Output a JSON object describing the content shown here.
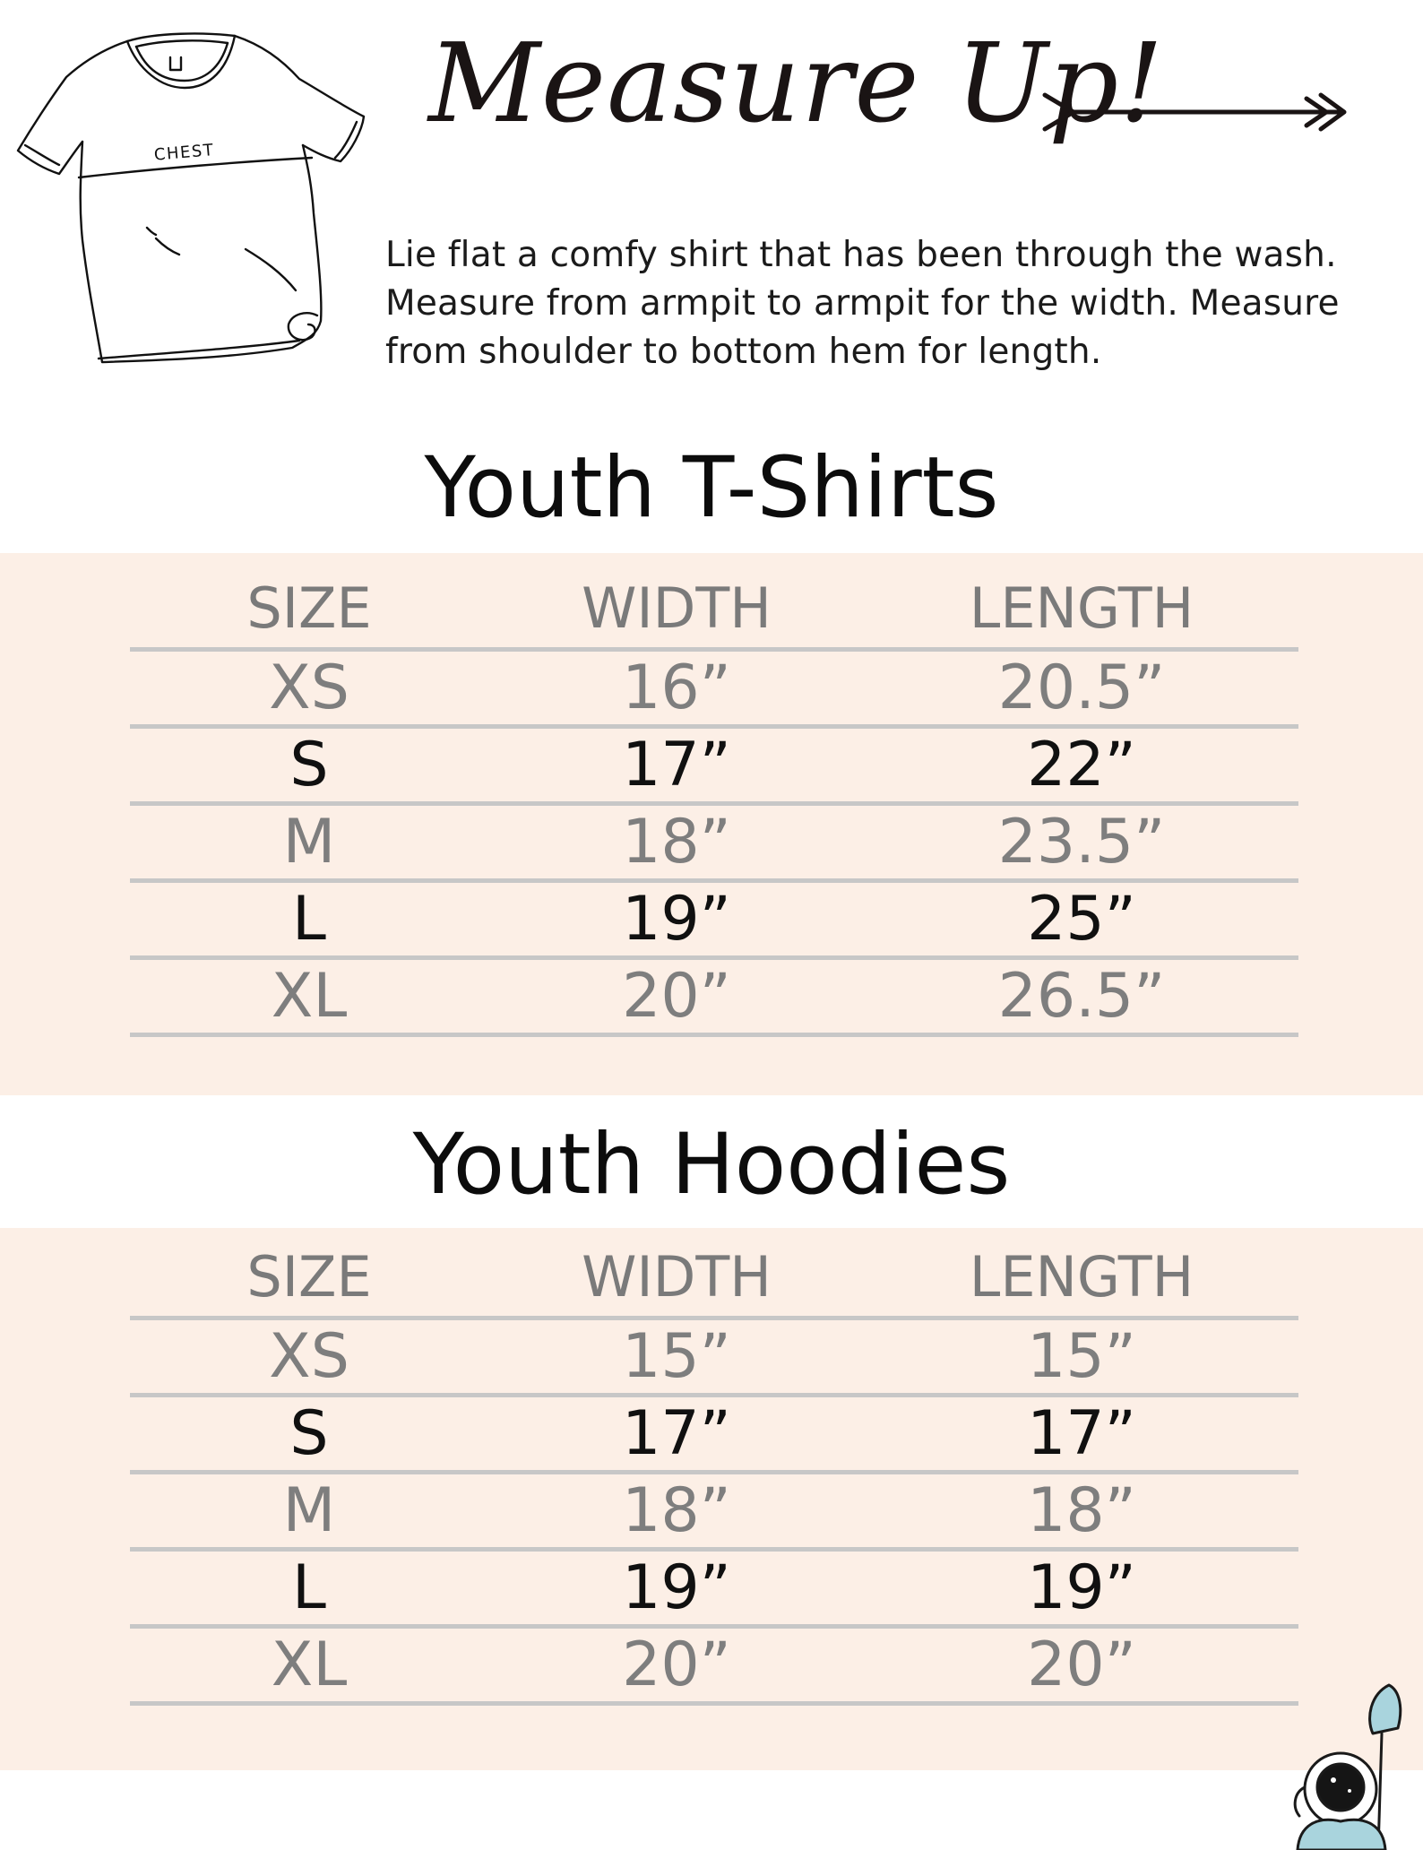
{
  "header": {
    "title": "Measure Up!",
    "shirt_label": "CHEST",
    "instructions": "Lie flat a comfy shirt that has been through the wash. Measure from armpit to armpit for the width. Measure from shoulder to bottom hem for length."
  },
  "tshirts": {
    "title": "Youth T-Shirts",
    "headers": [
      "SIZE",
      "WIDTH",
      "LENGTH"
    ],
    "rows": [
      [
        "XS",
        "16”",
        "20.5”"
      ],
      [
        "S",
        "17”",
        "22”"
      ],
      [
        "M",
        "18”",
        "23.5”"
      ],
      [
        "L",
        "19”",
        "25”"
      ],
      [
        "XL",
        "20”",
        "26.5”"
      ]
    ]
  },
  "hoodies": {
    "title": "Youth Hoodies",
    "headers": [
      "SIZE",
      "WIDTH",
      "LENGTH"
    ],
    "rows": [
      [
        "XS",
        "15”",
        "15”"
      ],
      [
        "S",
        "17”",
        "17”"
      ],
      [
        "M",
        "18”",
        "18”"
      ],
      [
        "L",
        "19”",
        "19”"
      ],
      [
        "XL",
        "20”",
        "20”"
      ]
    ]
  },
  "colors": {
    "band_background": "#fcefe6",
    "divider": "#c7c7c7",
    "text_dark": "#101010",
    "text_light": "#7e7e7e"
  }
}
